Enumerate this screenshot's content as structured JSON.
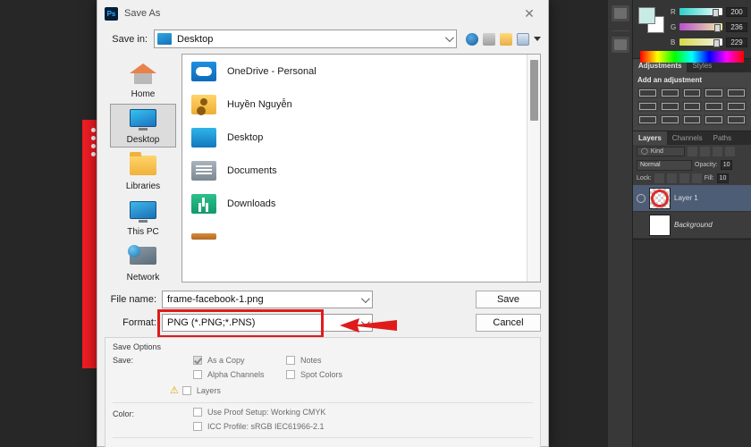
{
  "app": {
    "name": "Adobe Photoshop",
    "badge": "Ps"
  },
  "dialog": {
    "title": "Save As",
    "close_icon": "close-icon",
    "save_in": {
      "label": "Save in:",
      "value": "Desktop",
      "icon": "desktop-folder-icon"
    },
    "toolbar_icons": [
      "back-icon",
      "up-one-level-icon",
      "new-folder-icon",
      "view-menu-icon",
      "dropdown-arrow-icon"
    ],
    "places": [
      {
        "label": "Home",
        "icon": "home-icon",
        "selected": false
      },
      {
        "label": "Desktop",
        "icon": "desktop-icon",
        "selected": true
      },
      {
        "label": "Libraries",
        "icon": "libraries-folder-icon",
        "selected": false
      },
      {
        "label": "This PC",
        "icon": "this-pc-icon",
        "selected": false
      },
      {
        "label": "Network",
        "icon": "network-icon",
        "selected": false
      }
    ],
    "files": [
      {
        "name": "OneDrive - Personal",
        "icon": "onedrive-icon"
      },
      {
        "name": "Huyền Nguyễn",
        "icon": "user-folder-icon"
      },
      {
        "name": "Desktop",
        "icon": "desktop-folder-icon"
      },
      {
        "name": "Documents",
        "icon": "documents-folder-icon"
      },
      {
        "name": "Downloads",
        "icon": "downloads-folder-icon"
      }
    ],
    "file_name": {
      "label": "File name:",
      "value": "frame-facebook-1.png"
    },
    "format": {
      "label": "Format:",
      "value": "PNG (*.PNG;*.PNS)"
    },
    "buttons": {
      "save": "Save",
      "cancel": "Cancel"
    },
    "save_options": {
      "title": "Save Options",
      "save_label": "Save:",
      "checkboxes": [
        {
          "label": "As a Copy",
          "checked": true
        },
        {
          "label": "Notes",
          "checked": false
        },
        {
          "label": "Alpha Channels",
          "checked": false
        },
        {
          "label": "Spot Colors",
          "checked": false
        }
      ],
      "layers": {
        "label": "Layers",
        "checked": false,
        "warning_icon": "warning-triangle-icon"
      },
      "color_label": "Color:",
      "color_options": [
        {
          "label": "Use Proof Setup:  Working CMYK",
          "checked": false
        },
        {
          "label": "ICC Profile:  sRGB IEC61966-2.1",
          "checked": false
        }
      ]
    },
    "annotation": {
      "highlight_color": "#e01b1b",
      "arrow_icon": "red-arrow-icon"
    }
  },
  "panels": {
    "color": {
      "channels": [
        {
          "label": "R",
          "value": "200"
        },
        {
          "label": "G",
          "value": "236"
        },
        {
          "label": "B",
          "value": "229"
        }
      ],
      "foreground_color": "#c8ece5",
      "background_color": "#ffffff"
    },
    "adjustments": {
      "tabs": [
        {
          "label": "Adjustments",
          "active": true
        },
        {
          "label": "Styles",
          "active": false
        }
      ],
      "heading": "Add an adjustment"
    },
    "layers": {
      "tabs": [
        {
          "label": "Layers",
          "active": true
        },
        {
          "label": "Channels",
          "active": false
        },
        {
          "label": "Paths",
          "active": false
        }
      ],
      "filter_label": "Kind",
      "blend_mode": "Normal",
      "opacity_label": "Opacity:",
      "opacity_value": "10",
      "lock_label": "Lock:",
      "fill_label": "Fill:",
      "fill_value": "10",
      "items": [
        {
          "name": "Layer 1",
          "selected": true,
          "visible": true,
          "italic": false
        },
        {
          "name": "Background",
          "selected": false,
          "visible": false,
          "italic": true
        }
      ]
    }
  }
}
